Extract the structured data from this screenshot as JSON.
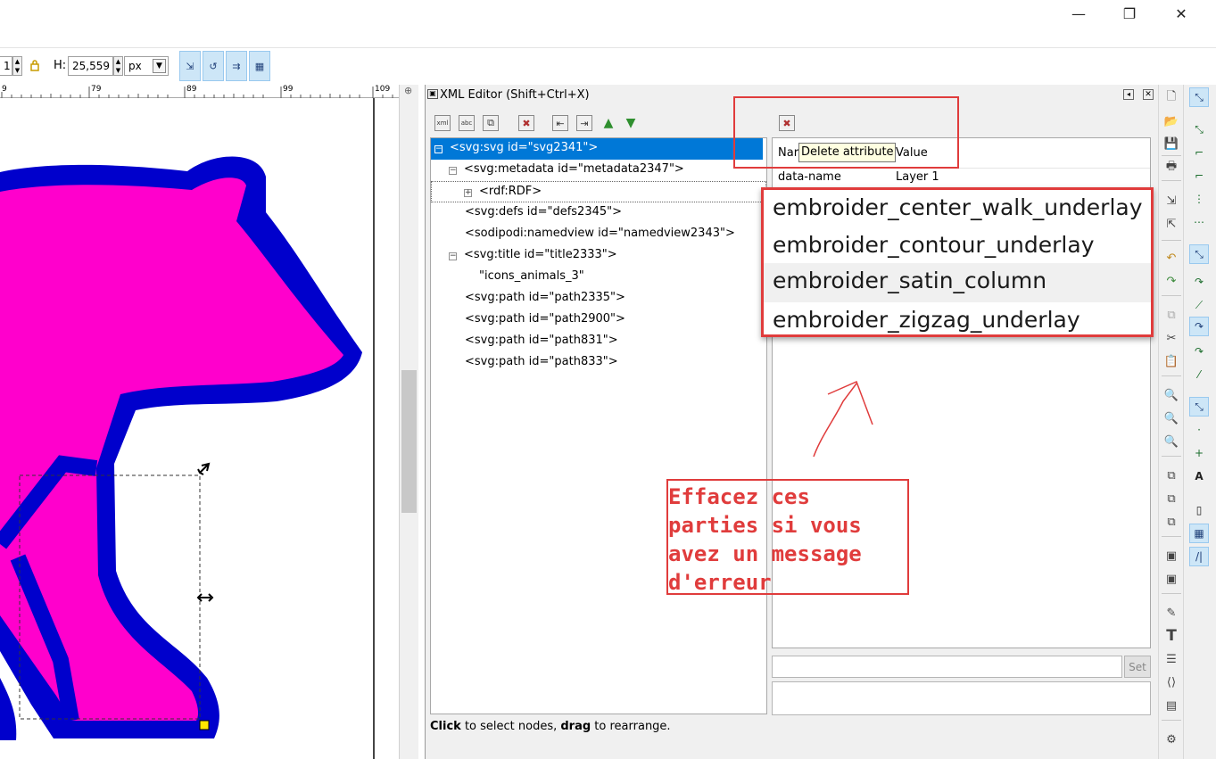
{
  "window": {
    "minimize_glyph": "—",
    "restore_glyph": "❐",
    "close_glyph": "✕"
  },
  "toolbar": {
    "w_value_fragment": "1",
    "h_label": "H:",
    "h_value": "25,559",
    "unit": "px",
    "lock_icon": "lock-icon"
  },
  "ruler": {
    "labels": [
      "9",
      "79",
      "89",
      "99",
      "109"
    ]
  },
  "xml_editor": {
    "title": "XML Editor (Shift+Ctrl+X)",
    "nodes": [
      {
        "label": "<svg:svg id=\"svg2341\">",
        "expander": "−",
        "selected": true
      },
      {
        "label": "<svg:metadata id=\"metadata2347\">",
        "expander": "−",
        "selected": false
      },
      {
        "label": "<rdf:RDF>",
        "expander": "+",
        "selected": false
      },
      {
        "label": "<svg:defs id=\"defs2345\">",
        "expander": "",
        "selected": false
      },
      {
        "label": "<sodipodi:namedview id=\"namedview2343\">",
        "expander": "",
        "selected": false
      },
      {
        "label": "<svg:title id=\"title2333\">",
        "expander": "−",
        "selected": false
      },
      {
        "label": "\"icons_animals_3\"",
        "expander": "",
        "selected": false
      },
      {
        "label": "<svg:path id=\"path2335\">",
        "expander": "",
        "selected": false
      },
      {
        "label": "<svg:path id=\"path2900\">",
        "expander": "",
        "selected": false
      },
      {
        "label": "<svg:path id=\"path831\">",
        "expander": "",
        "selected": false
      },
      {
        "label": "<svg:path id=\"path833\">",
        "expander": "",
        "selected": false
      }
    ],
    "attributes": {
      "name_header": "Nar",
      "value_header": "Value",
      "rows": [
        {
          "name": "data-name",
          "value": "Layer 1"
        }
      ]
    },
    "set_label": "Set",
    "status": {
      "click": "Click",
      "click_rest": " to select nodes, ",
      "drag": "drag",
      "drag_rest": " to rearrange."
    }
  },
  "tooltip": "Delete attribute",
  "zoomed_attributes": [
    "embroider_center_walk_underlay",
    "embroider_contour_underlay",
    "embroider_satin_column",
    "embroider_zigzag_underlay"
  ],
  "annotation": {
    "lines": [
      "Effacez ces",
      "parties si vous",
      "avez un message",
      "d'erreur"
    ],
    "color": "#e03c3c"
  },
  "colors": {
    "bear_fill": "#ff00cc",
    "bear_outline": "#0000cc",
    "selection": "#0078d7"
  }
}
